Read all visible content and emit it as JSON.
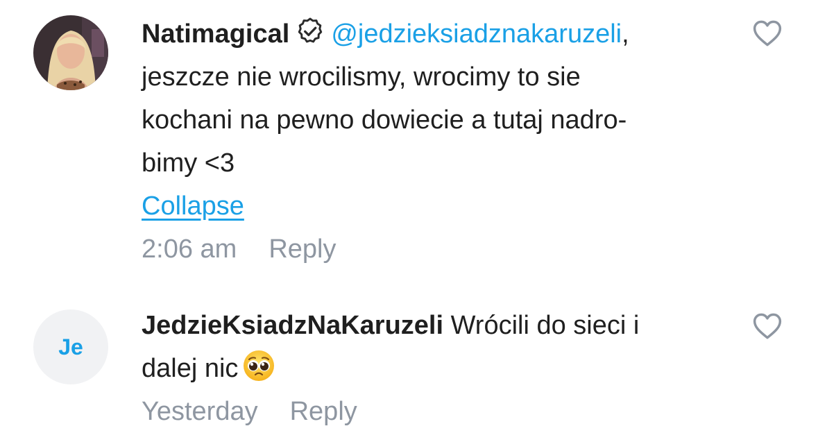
{
  "comments": [
    {
      "author": "Natimagical",
      "verified": true,
      "mention": "@jedzieksiadznakaruzeli",
      "text_after_mention": ",",
      "lines": [
        "jeszcze nie wrocilismy, wrocimy to sie",
        "kochani na pewno dowiecie a tutaj nadro-",
        "bimy <3"
      ],
      "collapse_label": "Collapse",
      "time": "2:06 am",
      "reply_label": "Reply",
      "liked": false,
      "avatar": {
        "type": "photo"
      }
    },
    {
      "author": "JedzieKsiadzNaKaruzeli",
      "verified": false,
      "text": "Wrócili do sieci i",
      "line2": "dalej nic",
      "emoji": "pleading-face-emoji",
      "time": "Yesterday",
      "reply_label": "Reply",
      "liked": false,
      "avatar": {
        "type": "initials",
        "initials": "Je",
        "color": "#1aa0e6"
      }
    }
  ],
  "colors": {
    "accent": "#1aa0e6",
    "text": "#1f1f1f",
    "muted": "#8e96a1",
    "heart": "#8e96a1"
  }
}
